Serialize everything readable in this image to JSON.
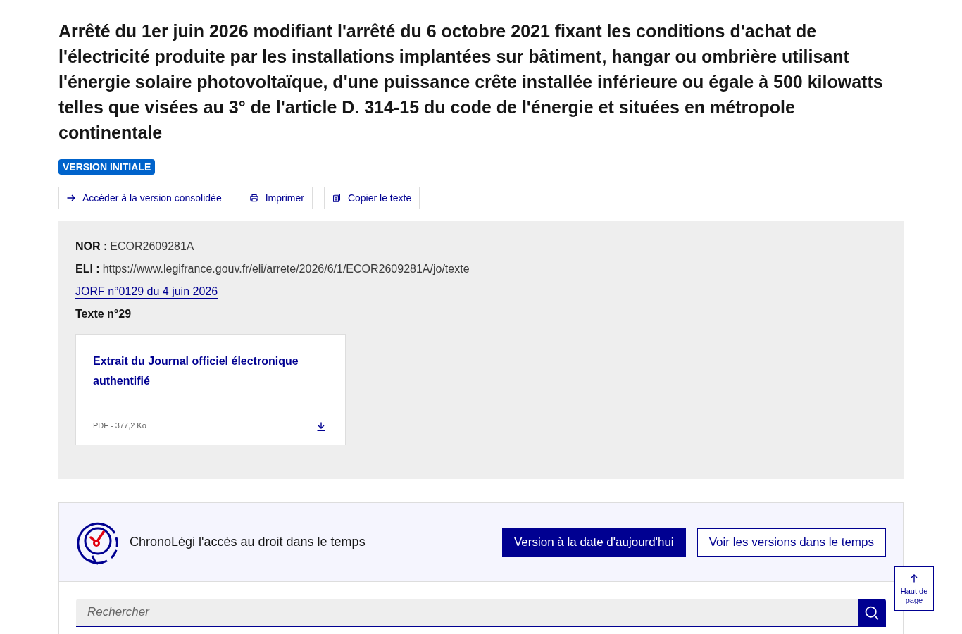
{
  "title": "Arrêté du 1er juin 2026 modifiant l'arrêté du 6 octobre 2021 fixant les conditions d'achat de l'électricité produite par les installations implantées sur bâtiment, hangar ou ombrière utilisant l'énergie solaire photovoltaïque, d'une puissance crête installée inférieure ou égale à 500 kilowatts telles que visées au 3° de l'article D. 314-15 du code de l'énergie et situées en métropole continentale",
  "badge": "VERSION INITIALE",
  "actions": [
    {
      "kind": "link",
      "label": "Accéder à la version consolidée"
    },
    {
      "kind": "print",
      "label": "Imprimer"
    },
    {
      "kind": "copy",
      "label": "Copier le texte"
    }
  ],
  "info": {
    "nor": "**NOR :** ECOR2609281A",
    "eli": "**ELI :** https://www.legifrance.gouv.fr/eli/arrete/2026/6/1/ECOR2609281A/jo/texte",
    "jorf_link": "JORF n°0129 du 4 juin 2026",
    "texte": "Texte n°29"
  },
  "download_card": {
    "title": "Extrait du Journal officiel électronique authentifié",
    "meta": "PDF - 377,2 Ko"
  },
  "chronolegi": {
    "title": "ChronoLégi l'accès au droit dans le temps",
    "buttons": [
      {
        "kind": "primary",
        "label": "Version à la date d'aujourd'hui"
      },
      {
        "kind": "secondary",
        "label": "Voir les versions dans le temps"
      }
    ]
  },
  "search": {
    "placeholder": "Rechercher"
  },
  "back_to_top": {
    "label": "Haut de page"
  }
}
